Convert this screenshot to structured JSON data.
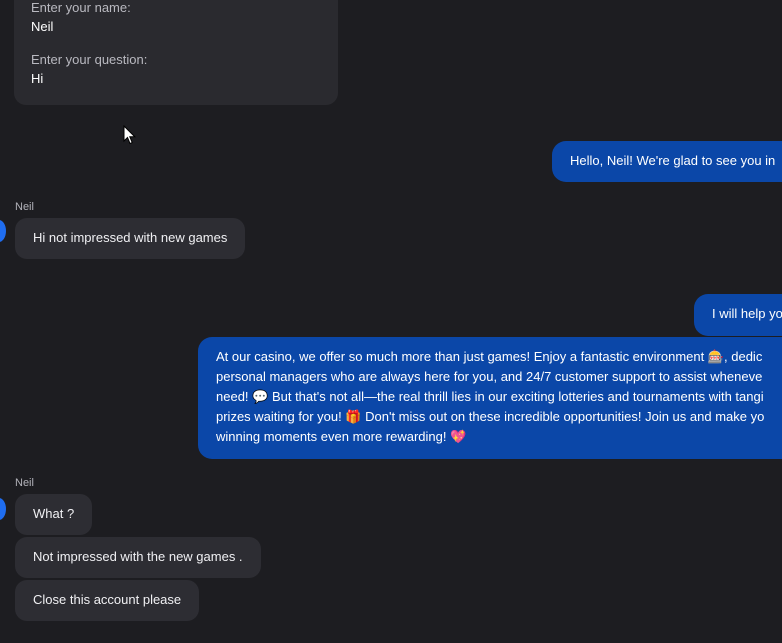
{
  "form": {
    "name_label": "Enter your name:",
    "name_value": "Neil",
    "question_label": "Enter your question:",
    "question_value": "Hi"
  },
  "messages": {
    "bot_greeting": "Hello, Neil! We're glad to see you in",
    "user_1_sender": "Neil",
    "user_1_text": "Hi not impressed with new games",
    "bot_help": "I will help yo",
    "bot_promo": "At our casino, we offer so much more than just games! Enjoy a fantastic environment 🎰, dedic personal managers who are always here for you, and 24/7 customer support to assist wheneve need! 💬 But that's not all—the real thrill lies in our exciting lotteries and tournaments with tangi prizes waiting for you! 🎁 Don't miss out on these incredible opportunities! Join us and make yo winning moments even more rewarding! 💖",
    "user_2_sender": "Neil",
    "user_2_text_1": "What ?",
    "user_2_text_2": "Not impressed with the new games .",
    "user_2_text_3": "Close this account please"
  },
  "colors": {
    "background": "#1d1d21",
    "bot_bubble": "#0b47a8",
    "user_bubble": "#2d2d33",
    "avatar": "#1f6df0"
  }
}
